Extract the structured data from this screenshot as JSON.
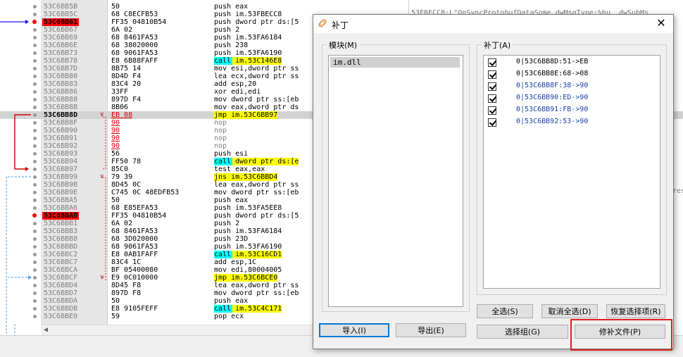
{
  "disasm": {
    "lines": [
      {
        "addr": "53C6BB5B",
        "bytes": "50",
        "ins": "push eax",
        "dot": "n"
      },
      {
        "addr": "53C6BB5C",
        "bytes": "68 C8ECFB53",
        "ins": "push im.53FBECC8",
        "dot": "n"
      },
      {
        "addr": "53C6BB61",
        "bytes": "FF35 04810B54",
        "ins": "push dword ptr ds:[5",
        "dot": "bp",
        "addrstyle": "red"
      },
      {
        "addr": "53C6BB67",
        "bytes": "6A 02",
        "ins": "push 2",
        "dot": "n"
      },
      {
        "addr": "53C6BB69",
        "bytes": "68 8461FA53",
        "ins": "push im.53FA6184",
        "dot": "n"
      },
      {
        "addr": "53C6BB6E",
        "bytes": "68 38020000",
        "ins": "push 238",
        "dot": "n"
      },
      {
        "addr": "53C6BB73",
        "bytes": "68 9061FA53",
        "ins": "push im.53FA6190",
        "dot": "n"
      },
      {
        "addr": "53C6BB78",
        "bytes": "E8 6B88FAFF",
        "ins": "call im.53C146E8",
        "dot": "n"
      },
      {
        "addr": "53C6BB7D",
        "bytes": "8B75 14",
        "ins": "mov esi,dword ptr ss",
        "dot": "n"
      },
      {
        "addr": "53C6BB80",
        "bytes": "8D4D F4",
        "ins": "lea ecx,dword ptr ss",
        "dot": "n"
      },
      {
        "addr": "53C6BB83",
        "bytes": "83C4 20",
        "ins": "add esp,20",
        "dot": "n"
      },
      {
        "addr": "53C6BB86",
        "bytes": "33FF",
        "ins": "xor edi,edi",
        "dot": "n"
      },
      {
        "addr": "53C6BB88",
        "bytes": "897D F4",
        "ins": "mov dword ptr ss:[eb",
        "dot": "n"
      },
      {
        "addr": "53C6BB8B",
        "bytes": "8B06",
        "ins": "mov eax,dword ptr ds",
        "dot": "n"
      },
      {
        "addr": "53C6BB8D",
        "bytes": "EB 08",
        "ins": "jmp im.53C6BB97",
        "dot": "n",
        "hl": true,
        "addrstyle": "cur"
      },
      {
        "addr": "53C6BB8F",
        "bytes": "90",
        "ins": "nop",
        "dot": "n"
      },
      {
        "addr": "53C6BB90",
        "bytes": "90",
        "ins": "nop",
        "dot": "n"
      },
      {
        "addr": "53C6BB91",
        "bytes": "90",
        "ins": "nop",
        "dot": "n"
      },
      {
        "addr": "53C6BB92",
        "bytes": "90",
        "ins": "nop",
        "dot": "n"
      },
      {
        "addr": "53C6BB93",
        "bytes": "56",
        "ins": "push esi",
        "dot": "n"
      },
      {
        "addr": "53C6BB94",
        "bytes": "FF50 78",
        "ins": "call dword ptr ds:[e",
        "dot": "n"
      },
      {
        "addr": "53C6BB97",
        "bytes": "85C0",
        "ins": "test eax,eax",
        "dot": "n"
      },
      {
        "addr": "53C6BB99",
        "bytes": "79 39",
        "ins": "jns im.53C6BBD4",
        "dot": "n"
      },
      {
        "addr": "53C6BB9B",
        "bytes": "8D45 0C",
        "ins": "lea eax,dword ptr ss",
        "dot": "n"
      },
      {
        "addr": "53C6BB9E",
        "bytes": "C745 0C 48EDFB53",
        "ins": "mov dword ptr ss:[eb",
        "dot": "n"
      },
      {
        "addr": "53C6BBA5",
        "bytes": "50",
        "ins": "push eax",
        "dot": "n"
      },
      {
        "addr": "53C6BBA6",
        "bytes": "68 E85EFA53",
        "ins": "push im.53FA5EE8",
        "dot": "n"
      },
      {
        "addr": "53C6BBAB",
        "bytes": "FF35 04810B54",
        "ins": "push dword ptr ds:[5",
        "dot": "bp",
        "addrstyle": "red"
      },
      {
        "addr": "53C6BBB1",
        "bytes": "6A 02",
        "ins": "push 2",
        "dot": "n"
      },
      {
        "addr": "53C6BBB3",
        "bytes": "68 8461FA53",
        "ins": "push im.53FA6184",
        "dot": "n"
      },
      {
        "addr": "53C6BBB8",
        "bytes": "68 3D020000",
        "ins": "push 23D",
        "dot": "n"
      },
      {
        "addr": "53C6BBBD",
        "bytes": "68 9061FA53",
        "ins": "push im.53FA6190",
        "dot": "n"
      },
      {
        "addr": "53C6BBC2",
        "bytes": "E8 0AB1FAFF",
        "ins": "call im.53C16CD1",
        "dot": "n"
      },
      {
        "addr": "53C6BBC7",
        "bytes": "83C4 1C",
        "ins": "add esp,1C",
        "dot": "n"
      },
      {
        "addr": "53C6BBCA",
        "bytes": "BF 05400080",
        "ins": "mov edi,80004005",
        "dot": "n"
      },
      {
        "addr": "53C6BBCF",
        "bytes": "E9 0C010000",
        "ins": "jmp im.53C6BCE0",
        "dot": "n"
      },
      {
        "addr": "53C6BBD4",
        "bytes": "8D45 F8",
        "ins": "lea eax,dword ptr ss",
        "dot": "n"
      },
      {
        "addr": "53C6BBD7",
        "bytes": "897D F8",
        "ins": "mov dword ptr ss:[eb",
        "dot": "n"
      },
      {
        "addr": "53C6BBDA",
        "bytes": "50",
        "ins": "push eax",
        "dot": "n"
      },
      {
        "addr": "53C6BBDB",
        "bytes": "E8 9105FEFF",
        "ins": "call im.53C4C171",
        "dot": "n"
      },
      {
        "addr": "53C6BBE0",
        "bytes": "59",
        "ins": "pop ecx",
        "dot": "n"
      }
    ],
    "comment_top": "53FBECC8:L\"OnSyncProtobufDataSome dwMsgType:%hu  dwSubMs",
    "comment_right": "res"
  },
  "dialog": {
    "title": "补丁",
    "modules_label": "模块(M)",
    "modules": [
      "im.dll"
    ],
    "patches_label": "补丁(A)",
    "patches": [
      {
        "text": "0|53C6BB8D:51->EB",
        "checked": true,
        "color": "black"
      },
      {
        "text": "0|53C6BB8E:68->08",
        "checked": true,
        "color": "black"
      },
      {
        "text": "0|53C6BB8F:38->90",
        "checked": true,
        "color": "blue"
      },
      {
        "text": "0|53C6BB90:ED->90",
        "checked": true,
        "color": "blue"
      },
      {
        "text": "0|53C6BB91:FB->90",
        "checked": true,
        "color": "blue"
      },
      {
        "text": "0|53C6BB92:53->90",
        "checked": true,
        "color": "blue"
      }
    ],
    "buttons": {
      "import": "导入(I)",
      "export": "导出(E)",
      "select_all": "全选(S)",
      "deselect_all": "取消全选(D)",
      "restore": "恢复选择项(R)",
      "select_group": "选择组(G)",
      "patch_file": "修补文件(P)"
    },
    "close_icon": "close-icon",
    "title_icon": "patch-bandage-icon"
  },
  "colors": {
    "breakpoint": "#ff0000",
    "call_highlight": "#00ffff",
    "jump_highlight": "#ffff00",
    "annotation_box": "#e0201c"
  }
}
